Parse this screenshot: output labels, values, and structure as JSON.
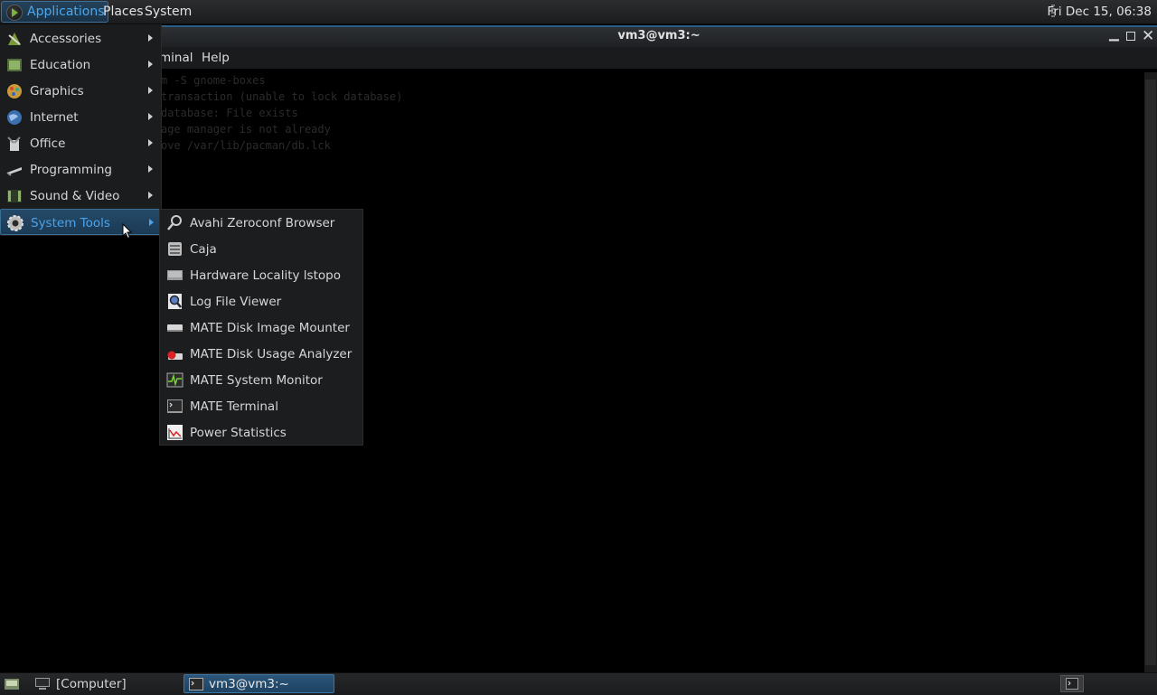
{
  "top_panel": {
    "applications": "Applications",
    "places": "Places",
    "system": "System",
    "clock": "Fri Dec 15, 06:38"
  },
  "window": {
    "title": "vm3@vm3:~",
    "menu_terminal": "minal",
    "menu_help": "Help",
    "terminal_lines": [
      "m -S gnome-boxes",
      "transaction (unable to lock database)",
      "database: File exists",
      "age manager is not already",
      "ove /var/lib/pacman/db.lck"
    ]
  },
  "app_menu": {
    "categories": [
      {
        "label": "Accessories",
        "icon": "accessories-icon"
      },
      {
        "label": "Education",
        "icon": "education-icon"
      },
      {
        "label": "Graphics",
        "icon": "graphics-icon"
      },
      {
        "label": "Internet",
        "icon": "internet-icon"
      },
      {
        "label": "Office",
        "icon": "office-icon"
      },
      {
        "label": "Programming",
        "icon": "programming-icon"
      },
      {
        "label": "Sound & Video",
        "icon": "sound-video-icon"
      },
      {
        "label": "System Tools",
        "icon": "system-tools-icon"
      }
    ],
    "active": "System Tools"
  },
  "submenu": {
    "items": [
      {
        "label": "Avahi Zeroconf Browser",
        "icon": "avahi-icon"
      },
      {
        "label": "Caja",
        "icon": "caja-icon"
      },
      {
        "label": "Hardware Locality lstopo",
        "icon": "hardware-icon"
      },
      {
        "label": "Log File Viewer",
        "icon": "log-viewer-icon"
      },
      {
        "label": "MATE Disk Image Mounter",
        "icon": "disk-mounter-icon"
      },
      {
        "label": "MATE Disk Usage Analyzer",
        "icon": "disk-usage-icon"
      },
      {
        "label": "MATE System Monitor",
        "icon": "system-monitor-icon"
      },
      {
        "label": "MATE Terminal",
        "icon": "terminal-icon"
      },
      {
        "label": "Power Statistics",
        "icon": "power-stats-icon"
      }
    ]
  },
  "bottom_panel": {
    "computer_task": "[Computer]",
    "terminal_task": "vm3@vm3:~"
  }
}
